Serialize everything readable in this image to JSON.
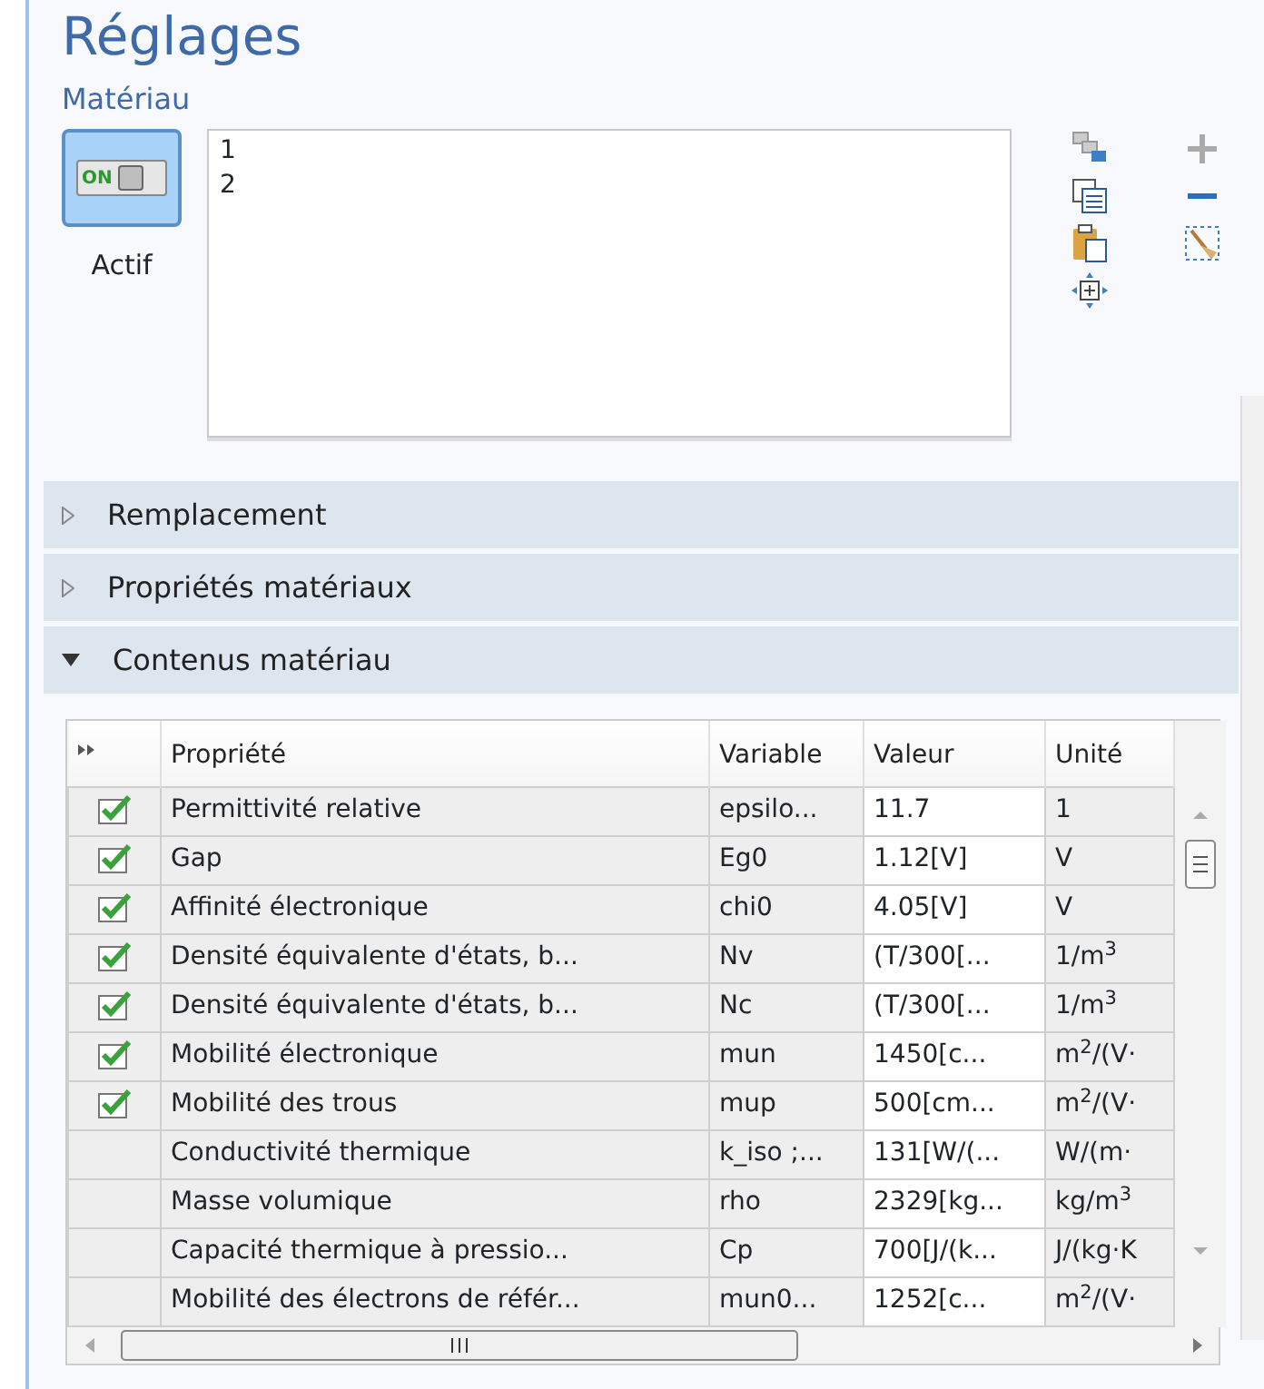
{
  "title": "Réglages",
  "subtitle": "Matériau",
  "active_toggle": {
    "label": "Actif",
    "state_text": "ON",
    "on": true
  },
  "selection_list": [
    "1",
    "2"
  ],
  "sections": [
    {
      "label": "Remplacement",
      "expanded": false
    },
    {
      "label": "Propriétés matériaux",
      "expanded": false
    },
    {
      "label": "Contenus matériau",
      "expanded": true
    }
  ],
  "table": {
    "columns": [
      "Propriété",
      "Variable",
      "Valeur",
      "Unité"
    ],
    "rows": [
      {
        "checked": true,
        "property": "Permittivité relative",
        "variable": "epsilo...",
        "value": "11.7",
        "unit": "1"
      },
      {
        "checked": true,
        "property": "Gap",
        "variable": "Eg0",
        "value": "1.12[V]",
        "unit": "V"
      },
      {
        "checked": true,
        "property": "Affinité électronique",
        "variable": "chi0",
        "value": "4.05[V]",
        "unit": "V"
      },
      {
        "checked": true,
        "property": "Densité équivalente d'états, b...",
        "variable": "Nv",
        "value": "(T/300[...",
        "unit": "1/m$^{3}$"
      },
      {
        "checked": true,
        "property": "Densité équivalente d'états, b...",
        "variable": "Nc",
        "value": "(T/300[...",
        "unit": "1/m$^{3}$"
      },
      {
        "checked": true,
        "property": "Mobilité électronique",
        "variable": "mun",
        "value": "1450[c...",
        "unit": "m$^{2}$/(V·"
      },
      {
        "checked": true,
        "property": "Mobilité des trous",
        "variable": "mup",
        "value": "500[cm...",
        "unit": "m$^{2}$/(V·"
      },
      {
        "checked": false,
        "property": "Conductivité thermique",
        "variable": "k_iso ;...",
        "value": "131[W/(...",
        "unit": "W/(m·"
      },
      {
        "checked": false,
        "property": "Masse volumique",
        "variable": "rho",
        "value": "2329[kg...",
        "unit": "kg/m$^{3}$"
      },
      {
        "checked": false,
        "property": "Capacité thermique à pressio...",
        "variable": "Cp",
        "value": "700[J/(k...",
        "unit": "J/(kg·K"
      },
      {
        "checked": false,
        "property": "Mobilité des électrons de référ...",
        "variable": "mun0...",
        "value": "1252[c...",
        "unit": "m$^{2}$/(V·"
      }
    ]
  }
}
